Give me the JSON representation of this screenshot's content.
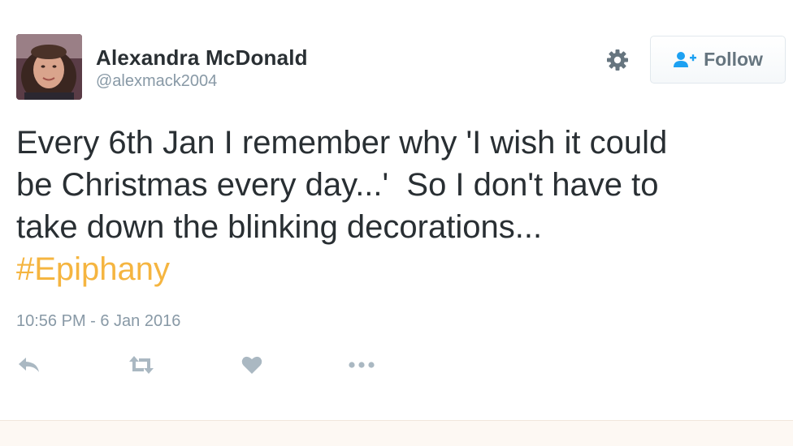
{
  "user": {
    "display_name": "Alexandra McDonald",
    "handle": "@alexmack2004",
    "avatar": "profile-photo"
  },
  "follow_button": {
    "label": "Follow",
    "icon": "add-user-icon"
  },
  "tweet": {
    "lines": [
      "Every 6th Jan I remember why 'I wish it could",
      "be Christmas every day...'  So I don't have to",
      "take down the blinking decorations..."
    ],
    "hashtag": "#Epiphany",
    "timestamp": "10:56 PM - 6 Jan 2016"
  },
  "actions": [
    "reply-icon",
    "retweet-icon",
    "like-icon",
    "more-icon"
  ],
  "colors": {
    "hashtag": "#f5b540",
    "text": "#292f33",
    "muted": "#8899a6",
    "icon": "#aab8c2"
  }
}
